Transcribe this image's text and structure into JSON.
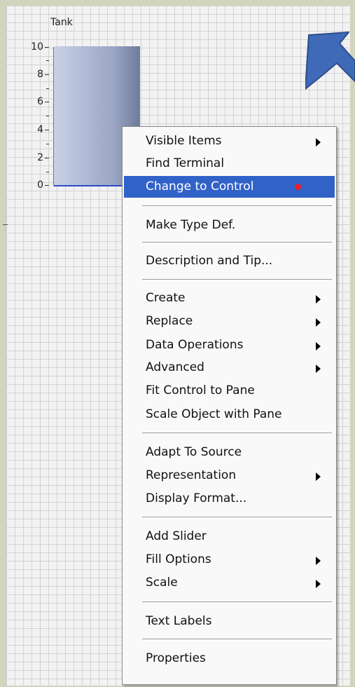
{
  "tank": {
    "label": "Tank",
    "scale_ticks": [
      "10",
      "8",
      "6",
      "4",
      "2",
      "0"
    ],
    "value": 10,
    "range": [
      0,
      10
    ],
    "fill_color": "#a9b4d2",
    "baseline_color": "#2c4cc8"
  },
  "arrow": {
    "icon": "arrow-down-left-icon",
    "color": "#3e6ab7"
  },
  "context_menu": {
    "items": {
      "visible_items": "Visible Items",
      "find_terminal": "Find Terminal",
      "change_to_control": "Change to Control",
      "make_type_def": "Make Type Def.",
      "description_and_tip": "Description and Tip...",
      "create": "Create",
      "replace": "Replace",
      "data_operations": "Data Operations",
      "advanced": "Advanced",
      "fit_control_to_pane": "Fit Control to Pane",
      "scale_object_with_pane": "Scale Object with Pane",
      "adapt_to_source": "Adapt To Source",
      "representation": "Representation",
      "display_format": "Display Format...",
      "add_slider": "Add Slider",
      "fill_options": "Fill Options",
      "scale": "Scale",
      "text_labels": "Text Labels",
      "properties": "Properties"
    },
    "highlight_color": "#3162c8",
    "marker_color": "#e8202a"
  }
}
